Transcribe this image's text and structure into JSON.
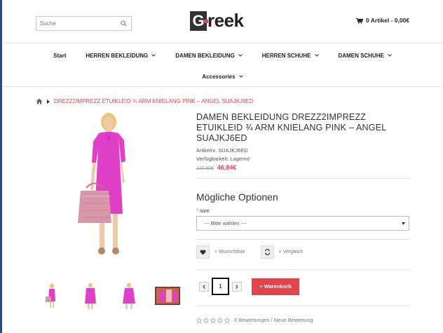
{
  "header": {
    "search_placeholder": "Suche",
    "logo_letter": "G",
    "logo_rest": "reek",
    "cart_label": "0 Artikel - 0,00€"
  },
  "nav": {
    "row1": [
      {
        "label": "Start",
        "has_dropdown": false
      },
      {
        "label": "HERREN BEKLEIDUNG",
        "has_dropdown": true
      },
      {
        "label": "DAMEN BEKLEIDUNG",
        "has_dropdown": true
      },
      {
        "label": "HERREN SCHUHE",
        "has_dropdown": true
      },
      {
        "label": "DAMEN SCHUHE",
        "has_dropdown": true
      }
    ],
    "row2": [
      {
        "label": "Accessories",
        "has_dropdown": true
      }
    ]
  },
  "breadcrumb": {
    "current": "DREZZ2IMPREZZ ETUIKLEID ¾ ARM KNIELANG PINK – ANGEL SUAJKJ6ED"
  },
  "product": {
    "title": "DAMEN BEKLEIDUNG DREZZ2IMPREZZ ETUIKLEID ¾ ARM KNIELANG PINK – ANGEL SUAJKJ6ED",
    "article_no": "Artikelnr. SUAJKJ6ED",
    "availability": "Verfügbarkeit: Lagernd",
    "old_price": "116,90€",
    "new_price": "46,84€",
    "dress_color": "#e040c8"
  },
  "options": {
    "title": "Mögliche Optionen",
    "size_required_mark": "*",
    "size_label": "size",
    "size_selected": "--- Bitte wählen ---"
  },
  "actions": {
    "wishlist_label": "+ Wunschliste",
    "compare_label": "+ Vergleich",
    "qty_value": "1",
    "add_to_cart_label": "+ Warenkorb"
  },
  "reviews": {
    "rating": 0,
    "text": "0 Bewertungen / Neue Bewertung"
  },
  "colors": {
    "accent": "#e0444c",
    "nav_border": "#2c4a8a"
  }
}
